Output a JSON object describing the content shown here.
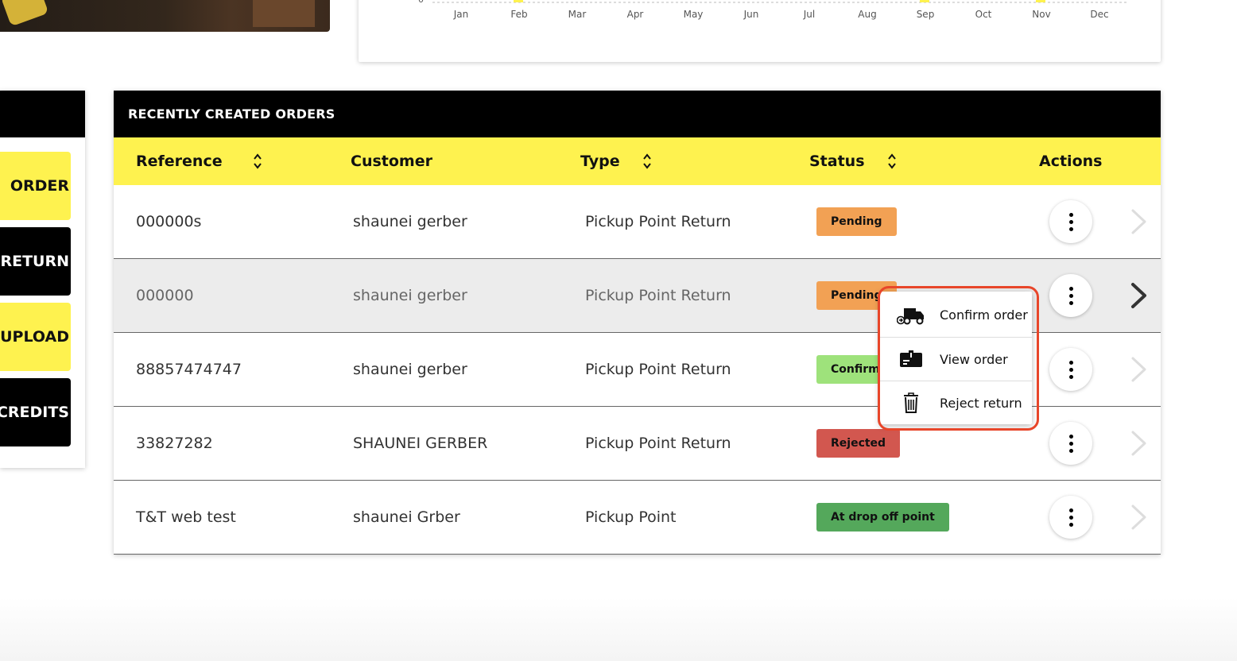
{
  "chart": {
    "months": [
      "Jan",
      "Feb",
      "Mar",
      "Apr",
      "May",
      "Jun",
      "Jul",
      "Aug",
      "Sep",
      "Oct",
      "Nov",
      "Dec"
    ],
    "highlight_color": "#fef24f"
  },
  "quick_buttons": [
    {
      "label": "ORDER",
      "style": "yellow"
    },
    {
      "label": "RETURN",
      "style": "black"
    },
    {
      "label": "UPLOAD",
      "style": "yellow"
    },
    {
      "label": "CREDITS",
      "style": "black"
    }
  ],
  "orders": {
    "title": "RECENTLY CREATED ORDERS",
    "columns": {
      "reference": "Reference",
      "customer": "Customer",
      "type": "Type",
      "status": "Status",
      "actions": "Actions"
    },
    "rows": [
      {
        "reference": "000000s",
        "customer": "shaunei gerber",
        "type": "Pickup Point Return",
        "status": "Pending",
        "status_color": "#f2a154"
      },
      {
        "reference": "000000",
        "customer": "shaunei gerber",
        "type": "Pickup Point Return",
        "status": "Pending",
        "status_color": "#f2a154"
      },
      {
        "reference": "88857474747",
        "customer": "shaunei gerber",
        "type": "Pickup Point Return",
        "status": "Confirmed",
        "status_color": "#9ee27b"
      },
      {
        "reference": "33827282",
        "customer": "SHAUNEI GERBER",
        "type": "Pickup Point Return",
        "status": "Rejected",
        "status_color": "#d2574f"
      },
      {
        "reference": "T&T web test",
        "customer": "shaunei Grber",
        "type": "Pickup Point",
        "status": "At drop off point",
        "status_color": "#54a85b"
      }
    ]
  },
  "menu": {
    "items": [
      {
        "label": "Confirm order",
        "icon": "delivery-truck-icon"
      },
      {
        "label": "View order",
        "icon": "order-box-icon"
      },
      {
        "label": "Reject return",
        "icon": "trash-icon"
      }
    ],
    "outline_color": "#e8462a"
  }
}
